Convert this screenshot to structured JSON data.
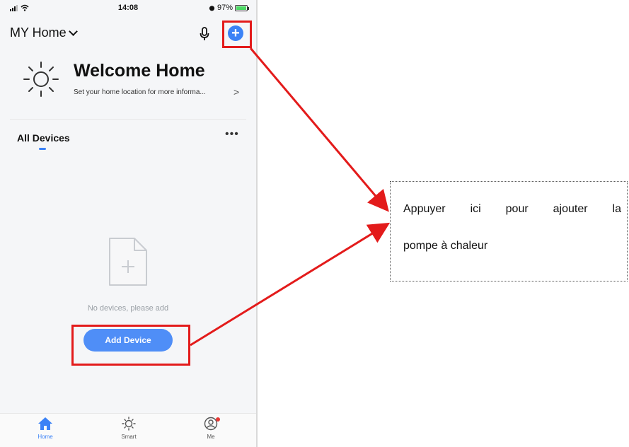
{
  "status_bar": {
    "time": "14:08",
    "battery": "97%"
  },
  "header": {
    "home_name": "MY Home"
  },
  "welcome": {
    "title": "Welcome Home",
    "subtitle": "Set your home location for more informa...",
    "arrow": ">"
  },
  "devices": {
    "tab_label": "All Devices",
    "more": "•••",
    "empty_text": "No devices, please add",
    "add_button": "Add Device"
  },
  "tabbar": {
    "items": [
      {
        "label": "Home"
      },
      {
        "label": "Smart"
      },
      {
        "label": "Me"
      }
    ]
  },
  "annotation": {
    "line1": "Appuyer ici pour ajouter la",
    "line2": "pompe à chaleur"
  },
  "colors": {
    "accent": "#3b82f6",
    "highlight": "#e31b1b",
    "battery": "#4cd964"
  },
  "icons": [
    "signal-icon",
    "wifi-icon",
    "alarm-icon",
    "battery-icon",
    "chevron-down-icon",
    "microphone-icon",
    "plus-circle-icon",
    "sun-icon",
    "empty-document-plus-icon",
    "home-icon",
    "smart-icon",
    "profile-icon"
  ]
}
